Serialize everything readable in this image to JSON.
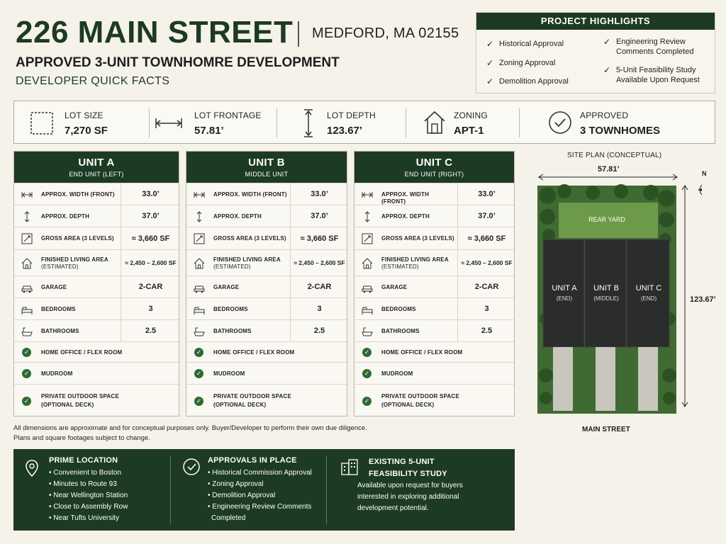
{
  "header": {
    "title": "226 MAIN STREET",
    "location": "MEDFORD, MA 02155",
    "subtitle": "APPROVED 3-UNIT TOWNHOMRE DEVELOPMENT",
    "subtitle2": "DEVELOPER QUICK FACTS"
  },
  "highlights": {
    "title": "PROJECT HIGHLIGHTS",
    "left": [
      "Historical Approval",
      "Zoning Approval",
      "Demolition Approval"
    ],
    "right": [
      {
        "line1": "Engineering Review",
        "line2": "Comments Completed"
      },
      {
        "line1": "5-Unit Feasibility Study",
        "line2": "Available Upon Request"
      }
    ]
  },
  "facts": [
    {
      "label": "LOT SIZE",
      "value": "7,270 SF",
      "icon": "lot-size-icon"
    },
    {
      "label": "LOT FRONTAGE",
      "value": "57.81’",
      "icon": "frontage-icon"
    },
    {
      "label": "LOT DEPTH",
      "value": "123.67’",
      "icon": "depth-icon"
    },
    {
      "label": "ZONING",
      "value": "APT-1",
      "icon": "house-icon"
    },
    {
      "label": "APPROVED",
      "value": "3 TOWNHOMES",
      "icon": "check-circle-icon"
    }
  ],
  "units": [
    {
      "name": "UNIT A",
      "sub": "END UNIT (LEFT)"
    },
    {
      "name": "UNIT B",
      "sub": "MIDDLE UNIT"
    },
    {
      "name": "UNIT C",
      "sub": "END UNIT (RIGHT)"
    }
  ],
  "specs": [
    {
      "label": "APPROX. WIDTH (FRONT)",
      "label2": "",
      "value": "33.0’",
      "icon": "width-icon"
    },
    {
      "label": "APPROX. DEPTH",
      "label2": "",
      "value": "37.0’",
      "icon": "depth-icon"
    },
    {
      "label": "GROSS AREA (3 LEVELS)",
      "label2": "",
      "value": "≈ 3,660 SF",
      "icon": "area-icon"
    },
    {
      "label": "FINISHED LIVING AREA",
      "label2": "(ESTIMATED)",
      "value": "≈ 2,450 – 2,600 SF",
      "icon": "house-icon"
    },
    {
      "label": "GARAGE",
      "label2": "",
      "value": "2-CAR",
      "icon": "car-icon"
    },
    {
      "label": "BEDROOMS",
      "label2": "",
      "value": "3",
      "icon": "bed-icon"
    },
    {
      "label": "BATHROOMS",
      "label2": "",
      "value": "2.5",
      "icon": "bath-icon"
    }
  ],
  "features": [
    {
      "label": "HOME OFFICE / FLEX ROOM",
      "label2": ""
    },
    {
      "label": "MUDROOM",
      "label2": ""
    },
    {
      "label": "PRIVATE OUTDOOR SPACE",
      "label2": "(OPTIONAL DECK)"
    }
  ],
  "site_plan": {
    "title": "SITE PLAN (CONCEPTUAL)",
    "width": "57.81’",
    "depth": "123.67’",
    "rear_yard": "REAR YARD",
    "street": "MAIN STREET",
    "north": "N",
    "units": [
      {
        "name": "UNIT A",
        "sub": "(END)"
      },
      {
        "name": "UNIT B",
        "sub": "(MIDDLE)"
      },
      {
        "name": "UNIT C",
        "sub": "(END)"
      }
    ]
  },
  "disclaimer": {
    "line1": "All dimensions are approximate and for conceptual purposes only. Buyer/Developer to perform their own due diligence.",
    "line2": "Plans and square footages subject to change."
  },
  "bottom": {
    "location": {
      "title": "PRIME LOCATION",
      "items": [
        "• Convenient to Boston",
        "• Minutes to Route 93",
        "• Near Wellington Station",
        "• Close to Assembly Row",
        "• Near Tufts University"
      ]
    },
    "approvals": {
      "title": "APPROVALS IN PLACE",
      "items": [
        "• Historical Commission Approval",
        "• Zoning Approval",
        "• Demolition Approval",
        "• Engineering Review Comments",
        "Completed"
      ]
    },
    "study": {
      "title1": "EXISTING 5-UNIT",
      "title2": "FEASIBILITY STUDY",
      "lines": [
        "Available upon request for buyers",
        "interested in exploring additional",
        "development potential."
      ]
    }
  },
  "colors": {
    "brand_green": "#1d3a22",
    "check_green": "#2e6a33",
    "background": "#f5f2ea"
  }
}
